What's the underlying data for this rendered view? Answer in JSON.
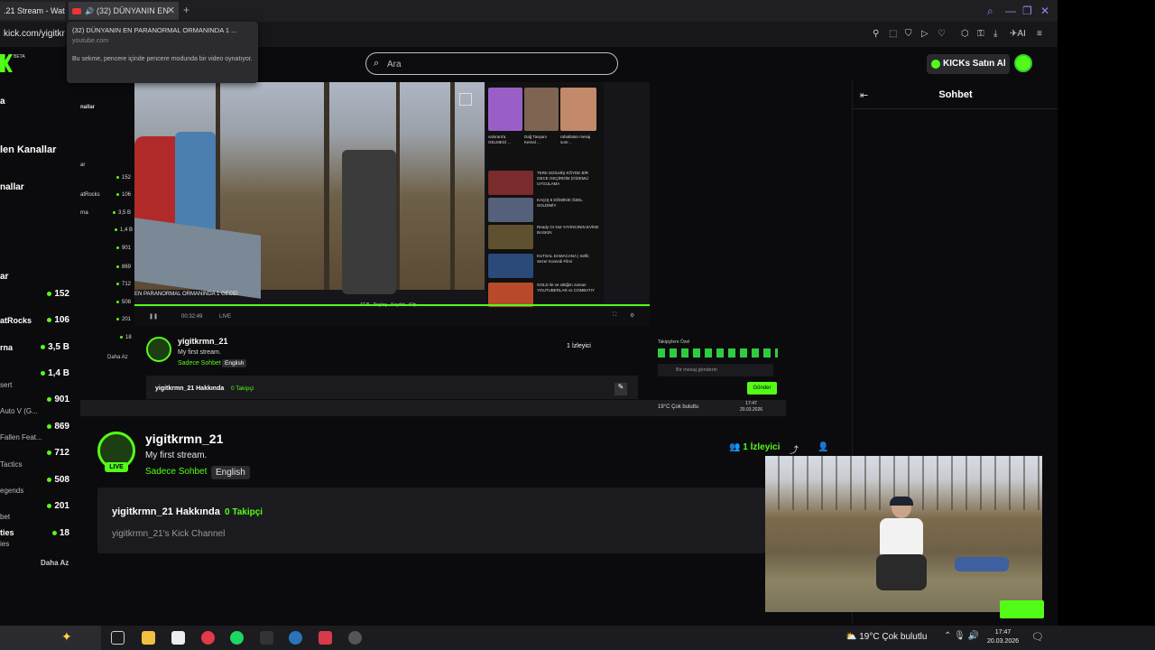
{
  "browser": {
    "tabs": [
      {
        "label": ".21 Stream - Wat"
      },
      {
        "label": "(32) DÜNYANIN EN"
      }
    ],
    "url": "kick.com/yigitkr",
    "tooltip": {
      "title": "(32) DÜNYANIN EN PARANORMAL ORMANINDA 1 ...",
      "domain": "youtube.com",
      "desc": "Bu sekme, pencere içinde pencere modunda bir video oynatıyor."
    },
    "ai_label": "AI"
  },
  "header": {
    "logo_badge": "BETA",
    "search_placeholder": "Ara",
    "buy_ai": "KICKs Satın Al"
  },
  "sidebar": {
    "sections": [
      {
        "label": "a"
      },
      {
        "label": "len Kanallar"
      },
      {
        "label": "nallar"
      },
      {
        "label": "ar"
      }
    ],
    "channels": [
      {
        "name": "",
        "category": "",
        "viewers": "152"
      },
      {
        "name": "atRocks",
        "category": "",
        "viewers": "106"
      },
      {
        "name": "rna",
        "category": "",
        "viewers": "3,5 B"
      },
      {
        "name": "",
        "category": "sert",
        "viewers": "1,4 B"
      },
      {
        "name": "",
        "category": "",
        "viewers": "901"
      },
      {
        "name": "",
        "category": "Auto V (G...",
        "viewers": ""
      },
      {
        "name": "",
        "category": "",
        "viewers": "869"
      },
      {
        "name": "Fallen Feat...",
        "category": "",
        "viewers": ""
      },
      {
        "name": "",
        "category": "Tactics",
        "viewers": "712"
      },
      {
        "name": "",
        "category": "",
        "viewers": "508"
      },
      {
        "name": "",
        "category": "egends",
        "viewers": ""
      },
      {
        "name": "",
        "category": "",
        "viewers": "201"
      },
      {
        "name": "",
        "category": "bet",
        "viewers": ""
      },
      {
        "name": "ties",
        "category": "ies",
        "viewers": "18"
      }
    ],
    "show_less": "Daha Az"
  },
  "inner_capture": {
    "video_caption": "EN PARANORMAL ORMANINDA 1 GECE!",
    "time": "00:32:49",
    "live": "LIVE",
    "yt_items": [
      {
        "title": "valorant'a GELMESİ ...",
        "meta": "2,2 Mn görüntüleme"
      },
      {
        "title": "Dağ Tavşanı Kemal ...",
        "meta": "14 Mn görüntüleme"
      },
      {
        "title": "rahatlatan mesaj sonr...",
        "meta": ""
      },
      {
        "title": "TERK EDİLMİŞ KÖYDE BİR GECE GEÇİRDİM (GİZEMLİ UYGULAMA",
        "meta": "Mesut Can Tomay"
      },
      {
        "title": "KAÇIŞ 5 DÖMİNİK ÖZEL SOLDİMİY",
        "meta": "Kaan Metin"
      },
      {
        "title": "Ready Or Not YAYINCININ EVİNE BASKIN",
        "meta": "EVDENEVE"
      },
      {
        "title": "KUTSAL DAMACANA | Sefik Sezer Komedi Filmi",
        "meta": "Film Atlası"
      },
      {
        "title": "GOLD ile ve sittiğim zaman YOUTUBERLAR vs COMBATIY",
        "meta": "Clobitsky"
      },
      {
        "title": "Ultra Sürdük Mi Videoda",
        "meta": ""
      }
    ],
    "yt_actions": [
      "47 B",
      "Paylaş",
      "Kaydet",
      "Klip"
    ],
    "channel_name": "yigitkrmn_21",
    "stream_title": "My first stream.",
    "category": "Sadece Sohbet",
    "language": "English",
    "viewers": "1 İzleyici",
    "about": "yigitkrmn_21 Hakkında",
    "followers": "0 Takipçi",
    "chat_label": "Takipçilere Özel",
    "chat_placeholder": "Bir mesaj gönderin",
    "send": "Gönder",
    "weather": "19°C Çok bulutlu",
    "clock_time": "17:47",
    "clock_date": "20.03.2026"
  },
  "channel": {
    "name": "yigitkrmn_21",
    "live": "LIVE",
    "stream_title": "My first stream.",
    "category": "Sadece Sohbet",
    "language": "English",
    "viewer_count": "1",
    "viewer_label": "İzleyici",
    "about_title": "yigitkrmn_21 Hakkında",
    "follower_count": "0",
    "follower_label": "Takipçi",
    "description": "yigitkrmn_21's Kick Channel"
  },
  "chat": {
    "title": "Sohbet"
  },
  "taskbar": {
    "weather": "19°C Çok bulutlu",
    "time": "17:47",
    "date": "20.03.2026"
  },
  "colors": {
    "accent": "#53fc18",
    "background": "#0b0b0d",
    "panel": "#1b1b1f"
  }
}
